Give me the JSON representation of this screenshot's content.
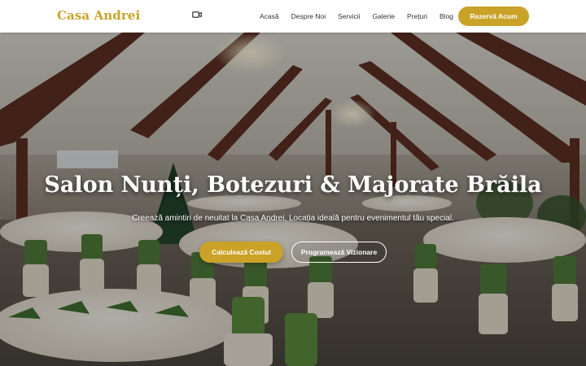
{
  "header": {
    "brand": "Casa Andrei",
    "nav": [
      {
        "label": "Acasă"
      },
      {
        "label": "Despre Noi"
      },
      {
        "label": "Servicii"
      },
      {
        "label": "Galerie"
      },
      {
        "label": "Prețuri"
      },
      {
        "label": "Blog"
      }
    ],
    "cta_label": "Rezervă Acum"
  },
  "hero": {
    "title": "Salon Nunți, Botezuri & Majorate Brăila",
    "subtitle": "Creează amintiri de neuitat la Casa Andrei. Locația ideală pentru evenimentul tău special.",
    "primary_button": "Calculează Costul",
    "secondary_button": "Programează Vizionare"
  },
  "colors": {
    "accent": "#c9a227",
    "nav_bg": "#ffffff",
    "nav_text": "#333333",
    "hero_text": "#ffffff"
  },
  "icons": {
    "video": "video-camera-icon"
  }
}
